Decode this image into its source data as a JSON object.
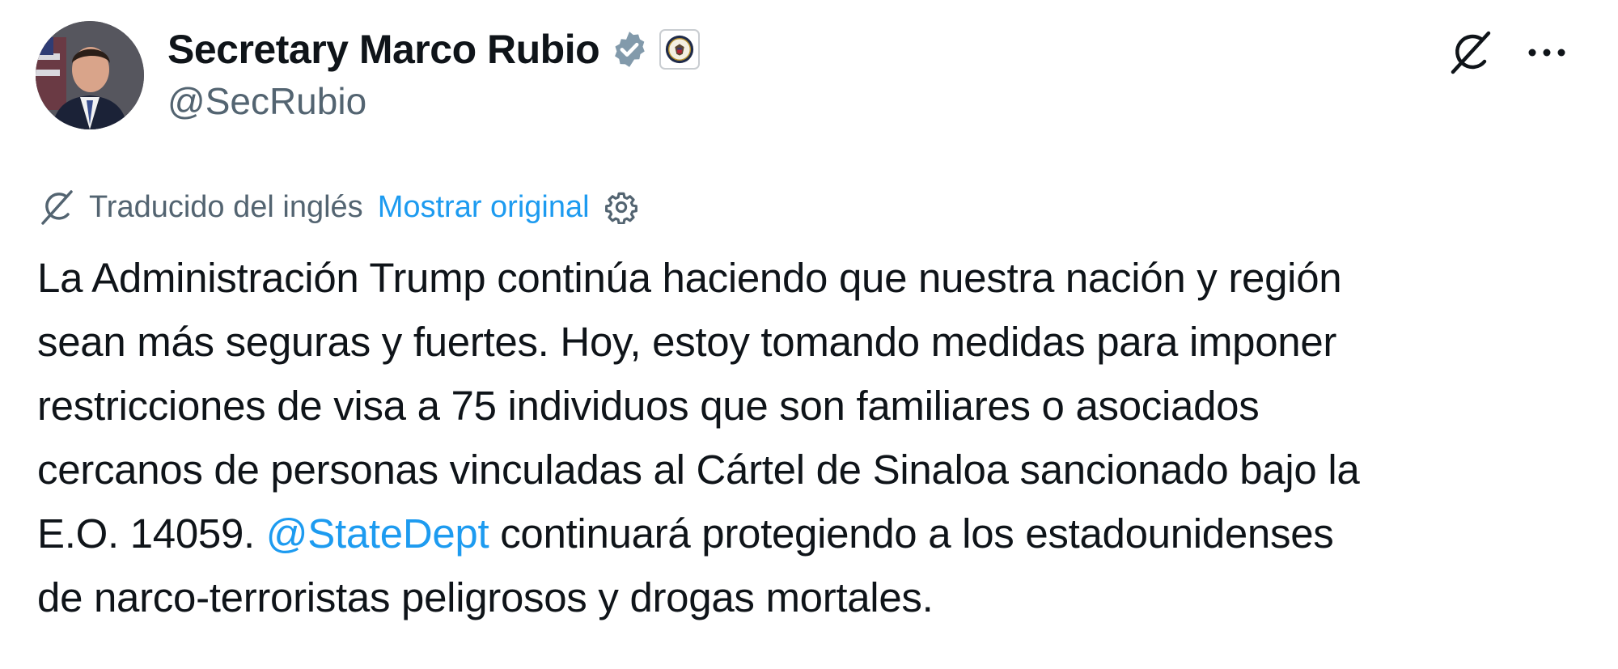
{
  "author": {
    "display_name": "Secretary Marco Rubio",
    "handle": "@SecRubio",
    "verified_icon": "verified-badge-icon",
    "affiliate_icon": "state-department-seal-icon"
  },
  "actions": {
    "grok_icon": "grok-icon",
    "more_icon": "more-options-icon"
  },
  "translation": {
    "icon": "translate-icon",
    "label": "Traducido del inglés",
    "show_original": "Mostrar original",
    "settings_icon": "settings-gear-icon"
  },
  "tweet": {
    "lines": [
      "La Administración Trump continúa haciendo que nuestra nación y región",
      "sean más seguras y fuertes. Hoy, estoy tomando medidas para imponer",
      "restricciones de visa a 75 individuos que son familiares o asociados",
      "cercanos de personas vinculadas al Cártel de Sinaloa sancionado bajo la"
    ],
    "line5_prefix": "E.O. 14059. ",
    "mention": "@StateDept",
    "line5_suffix": " continuará protegiendo a los estadounidenses",
    "line6": "de narco-terroristas peligrosos y drogas mortales."
  },
  "colors": {
    "link": "#1d9bf0",
    "secondary_text": "#536471",
    "primary_text": "#0f1419",
    "verified_badge": "#829aab"
  }
}
